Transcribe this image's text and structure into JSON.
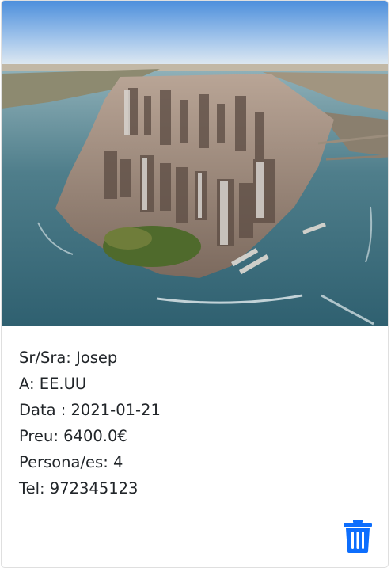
{
  "booking": {
    "image_alt": "Aerial view of Lower Manhattan",
    "name_line": "Sr/Sra: Josep",
    "destination_line": "A: EE.UU",
    "date_line": "Data : 2021-01-21",
    "price_line": "Preu: 6400.0€",
    "persons_line": "Persona/es: 4",
    "phone_line": "Tel: 972345123"
  },
  "actions": {
    "delete_icon": "trash-icon",
    "delete_color": "#0d6efd"
  }
}
